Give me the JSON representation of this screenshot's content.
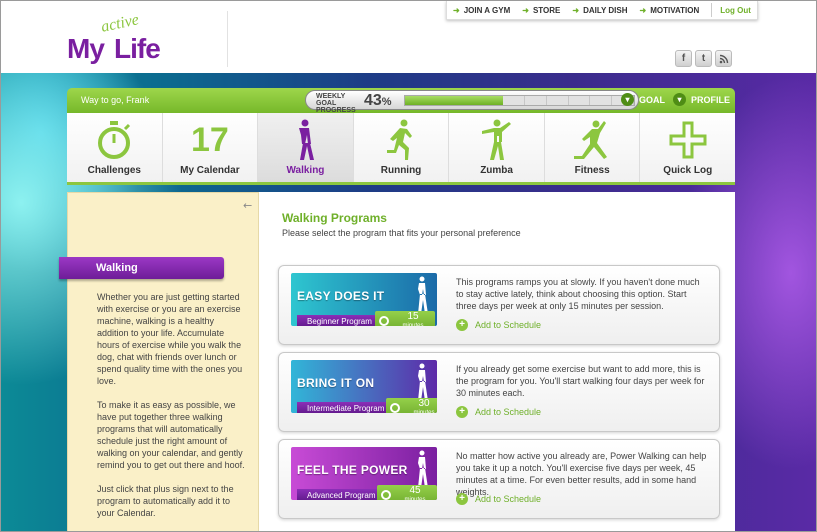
{
  "logo": {
    "my": "My",
    "active": "active",
    "life": "Life"
  },
  "topnav": {
    "items": [
      "JOIN A GYM",
      "STORE",
      "DAILY DISH",
      "MOTIVATION"
    ],
    "logout": "Log Out"
  },
  "social": [
    "f",
    "t",
    "rss"
  ],
  "status": {
    "greeting": "Way to go, Frank",
    "weekly_goal_label": "WEEKLY GOAL PROGRESS",
    "progress_value": "43",
    "progress_unit": "%",
    "progress_fraction": 0.43,
    "goal_label": "GOAL",
    "profile_label": "PROFILE"
  },
  "tiles": [
    {
      "label": "Challenges",
      "icon": "stopwatch-icon"
    },
    {
      "label": "My Calendar",
      "icon": "calendar-day-icon",
      "day": "17"
    },
    {
      "label": "Walking",
      "icon": "walker-icon",
      "active": true
    },
    {
      "label": "Running",
      "icon": "runner-icon"
    },
    {
      "label": "Zumba",
      "icon": "dancer-icon"
    },
    {
      "label": "Fitness",
      "icon": "fitness-icon"
    },
    {
      "label": "Quick Log",
      "icon": "plus-icon"
    }
  ],
  "sidebar": {
    "tab": "Walking",
    "paragraphs": [
      "Whether you are just getting started with exercise or you are an exercise machine, walking is a healthy addition to your life. Accumulate hours of exercise while you walk the dog, chat with friends over lunch or spend quality time with the ones you love.",
      "To make it as easy as possible, we have put together three walking programs that will automatically schedule just the right amount of walking on your calendar, and gently remind you to get out there and hoof.",
      "Just click that plus sign next to the program to automatically add it to your Calendar."
    ]
  },
  "main": {
    "title": "Walking Programs",
    "subtitle": "Please select the program that fits your personal preference",
    "programs": [
      {
        "banner": "EASY DOES IT",
        "level": "Beginner Program",
        "minutes": "15",
        "minutes_unit": "minutes",
        "description": "This programs ramps you at slowly.  If you haven't done much to stay active lately, think about choosing this option.  Start three days per week at only 15 minutes per session.",
        "add": "Add to Schedule",
        "colors": [
          "#2ec6d0",
          "#1b6aa8"
        ]
      },
      {
        "banner": "BRING IT ON",
        "level": "Intermediate Program",
        "minutes": "30",
        "minutes_unit": "minutes",
        "description": "If you already get some exercise but want to add more, this is the program for you.  You'll start walking four days per week for 30 minutes each.",
        "add": "Add to Schedule",
        "colors": [
          "#31b6d8",
          "#5e2aa8"
        ]
      },
      {
        "banner": "FEEL THE POWER",
        "level": "Advanced Program",
        "minutes": "45",
        "minutes_unit": "minutes",
        "description": "No matter how active you already are, Power Walking can help you take it up a notch.  You'll exercise five days per week, 45 minutes at a time.  For even better results, add in some hand weights.",
        "add": "Add to Schedule",
        "colors": [
          "#c84bd6",
          "#7a1fa0"
        ]
      }
    ]
  },
  "colors": {
    "brand_purple": "#7a1fa0",
    "brand_green": "#8cc63f"
  }
}
